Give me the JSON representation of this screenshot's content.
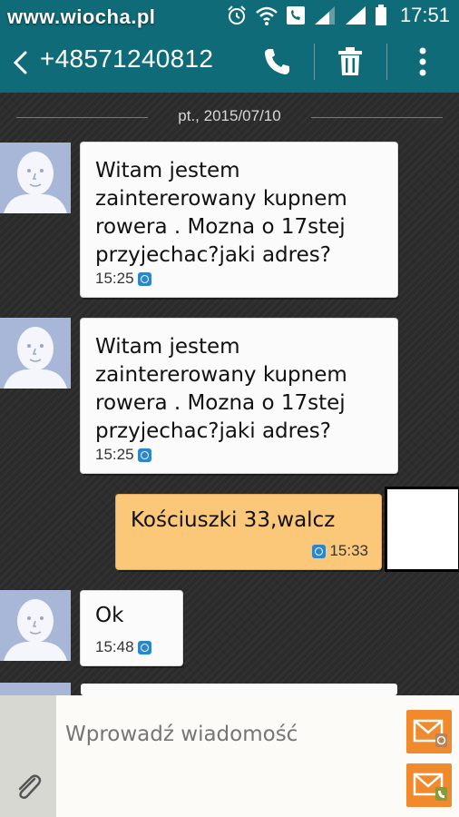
{
  "status_bar": {
    "watermark": "www.wiocha.pl",
    "time": "17:51",
    "icons": [
      "alarm-icon",
      "wifi-icon",
      "phone-status-icon",
      "signal-icon",
      "signal-icon",
      "battery-icon"
    ]
  },
  "header": {
    "title": "+48571240812",
    "back_icon": "chevron-left-icon",
    "actions": [
      "phone-icon",
      "trash-icon",
      "overflow-menu-icon"
    ]
  },
  "thread": {
    "date": "pt., 2015/07/10",
    "messages": [
      {
        "direction": "in",
        "text": "Witam jestem\nzaintererowany kupnem\nrowera . Mozna o 17stej\nprzyjechac?jaki adres?",
        "time": "15:25"
      },
      {
        "direction": "in",
        "text": "Witam jestem\nzaintererowany kupnem\nrowera . Mozna o 17stej\nprzyjechac?jaki adres?",
        "time": "15:25"
      },
      {
        "direction": "out",
        "text": "Kościuszki 33,walcz",
        "time": "15:33"
      },
      {
        "direction": "in",
        "text": "Ok",
        "time": "15:48"
      }
    ]
  },
  "composer": {
    "placeholder": "Wprowadź wiadomość",
    "send_buttons": [
      "send-sim1-icon",
      "send-sim2-icon"
    ]
  },
  "colors": {
    "header": "#0f6b78",
    "outgoing_bubble": "#fbc779",
    "incoming_bubble": "#fbfbfb",
    "send_button": "#f08a2c",
    "avatar": "#a8b7d8"
  }
}
